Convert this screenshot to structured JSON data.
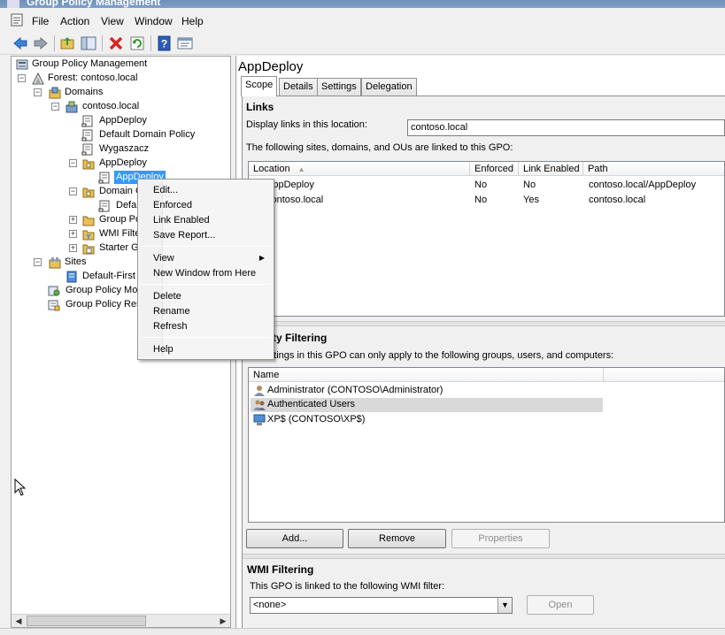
{
  "window": {
    "title": "Group Policy Management"
  },
  "menu": {
    "items": [
      "File",
      "Action",
      "View",
      "Window",
      "Help"
    ]
  },
  "toolbar": {
    "buttons": [
      "back-arrow-icon",
      "forward-arrow-icon",
      "up-folder-icon",
      "show-hide-tree-icon",
      "delete-icon",
      "refresh-icon",
      "help-icon",
      "properties-icon"
    ]
  },
  "tree": {
    "root": "Group Policy Management",
    "forest": "Forest: contoso.local",
    "domains": "Domains",
    "domain": "contoso.local",
    "link_appdeploy": "AppDeploy",
    "link_default_domain_policy": "Default Domain Policy",
    "link_wygaszacz": "Wygaszacz",
    "ou_appdeploy": "AppDeploy",
    "ou_appdeploy_link": "AppDeploy",
    "domain_controllers": "Domain C",
    "domain_controllers_link": "Defa",
    "group_policy_objects": "Group Po",
    "wmi_filters": "WMI Filte",
    "starter_gpos": "Starter G",
    "sites": "Sites",
    "default_first_site": "Default-First",
    "group_policy_modeling": "Group Policy Mod",
    "group_policy_results": "Group Policy Res"
  },
  "context_menu": {
    "edit": "Edit...",
    "enforced": "Enforced",
    "link_enabled": "Link Enabled",
    "save_report": "Save Report...",
    "view": "View",
    "new_window": "New Window from Here",
    "delete": "Delete",
    "rename": "Rename",
    "refresh": "Refresh",
    "help": "Help"
  },
  "details": {
    "title": "AppDeploy",
    "tabs": [
      "Scope",
      "Details",
      "Settings",
      "Delegation"
    ],
    "active_tab": "Scope",
    "links": {
      "header": "Links",
      "display_label": "Display links in this location:",
      "location_value": "contoso.local",
      "description": "The following sites, domains, and OUs are linked to this GPO:",
      "columns": [
        "Location",
        "Enforced",
        "Link Enabled",
        "Path"
      ],
      "rows": [
        {
          "location": "AppDeploy",
          "enforced": "No",
          "link_enabled": "No",
          "path": "contoso.local/AppDeploy"
        },
        {
          "location": "contoso.local",
          "enforced": "No",
          "link_enabled": "Yes",
          "path": "contoso.local"
        }
      ]
    },
    "security_filtering": {
      "header": "rity Filtering",
      "description": "ettings in this GPO can only apply to the following groups, users, and computers:",
      "columns": [
        "Name"
      ],
      "rows": [
        "Administrator (CONTOSO\\Administrator)",
        "Authenticated Users",
        "XP$ (CONTOSO\\XP$)"
      ],
      "buttons": {
        "add": "Add...",
        "remove": "Remove",
        "properties": "Properties"
      }
    },
    "wmi_filtering": {
      "header": "WMI Filtering",
      "description": "This GPO is linked to the following WMI filter:",
      "selected": "<none>",
      "open_button": "Open"
    }
  },
  "colors": {
    "selection": "#3399ff",
    "selection_inactive": "#d9d9d9",
    "pane_background": "#ffffff",
    "chrome": "#f0f0f0"
  }
}
